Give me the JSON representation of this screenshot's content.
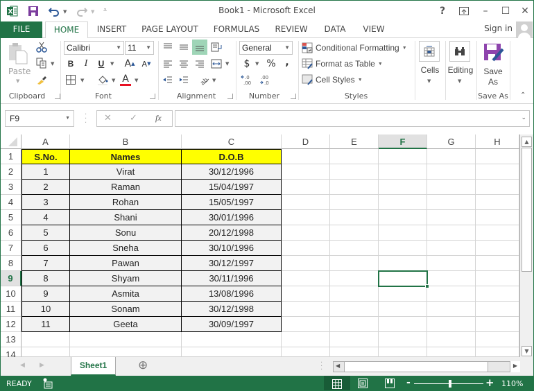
{
  "window": {
    "title": "Book1 - Microsoft Excel",
    "accent": "#217346"
  },
  "qat": {
    "excel_icon": "excel-logo-icon",
    "save_icon": "save-icon",
    "undo_icon": "undo-icon",
    "redo_icon": "redo-icon",
    "customize_icon": "customize-qat-icon"
  },
  "window_controls": {
    "help": "?",
    "ribbon_display": "ribbon-display-options-icon",
    "minimize": "–",
    "maximize": "☐",
    "close": "✕"
  },
  "tabs": [
    "FILE",
    "HOME",
    "INSERT",
    "PAGE LAYOUT",
    "FORMULAS",
    "REVIEW",
    "DATA",
    "VIEW"
  ],
  "active_tab": "HOME",
  "account": {
    "sign_in": "Sign in"
  },
  "ribbon": {
    "clipboard": {
      "label": "Clipboard",
      "paste": "Paste"
    },
    "font": {
      "label": "Font",
      "name": "Calibri",
      "size": "11",
      "bold": "B",
      "italic": "I",
      "underline": "U",
      "font_color": "#e81123"
    },
    "alignment": {
      "label": "Alignment"
    },
    "number": {
      "label": "Number",
      "format": "General",
      "currency": "$",
      "percent": "%",
      "comma": ",",
      "inc_decimal": "←.0 .00",
      "dec_decimal": ".00 →.0"
    },
    "styles": {
      "label": "Styles",
      "conditional_formatting": "Conditional Formatting",
      "format_as_table": "Format as Table",
      "cell_styles": "Cell Styles"
    },
    "cells": {
      "label": "Cells"
    },
    "editing": {
      "label": "Editing"
    },
    "save_as": {
      "label": "Save As",
      "button_line1": "Save",
      "button_line2": "As"
    }
  },
  "formula_bar": {
    "name_box": "F9",
    "cancel": "✕",
    "enter": "✓",
    "fx": "fx",
    "value": ""
  },
  "sheet": {
    "columns": [
      "A",
      "B",
      "C",
      "D",
      "E",
      "F",
      "G",
      "H"
    ],
    "selected_column": "F",
    "rows": [
      "1",
      "2",
      "3",
      "4",
      "5",
      "6",
      "7",
      "8",
      "9",
      "10",
      "11",
      "12",
      "13",
      "14"
    ],
    "selected_row": "9",
    "selected_cell": "F9",
    "table_header": [
      "S.No.",
      "Names",
      "D.O.B"
    ],
    "table_header_fill": "#ffff00",
    "table_rows": [
      [
        "1",
        "Virat",
        "30/12/1996"
      ],
      [
        "2",
        "Raman",
        "15/04/1997"
      ],
      [
        "3",
        "Rohan",
        "15/05/1997"
      ],
      [
        "4",
        "Shani",
        "30/01/1996"
      ],
      [
        "5",
        "Sonu",
        "20/12/1998"
      ],
      [
        "6",
        "Sneha",
        "30/10/1996"
      ],
      [
        "7",
        "Pawan",
        "30/12/1997"
      ],
      [
        "8",
        "Shyam",
        "30/11/1996"
      ],
      [
        "9",
        "Asmita",
        "13/08/1996"
      ],
      [
        "10",
        "Sonam",
        "30/12/1998"
      ],
      [
        "11",
        "Geeta",
        "30/09/1997"
      ]
    ]
  },
  "sheet_tabs": {
    "tabs": [
      "Sheet1"
    ],
    "active": "Sheet1",
    "add_icon": "⊕"
  },
  "status_bar": {
    "mode": "READY",
    "zoom": "110%",
    "zoom_minus": "-",
    "zoom_plus": "+",
    "zoom_level_fraction": 0.52
  }
}
